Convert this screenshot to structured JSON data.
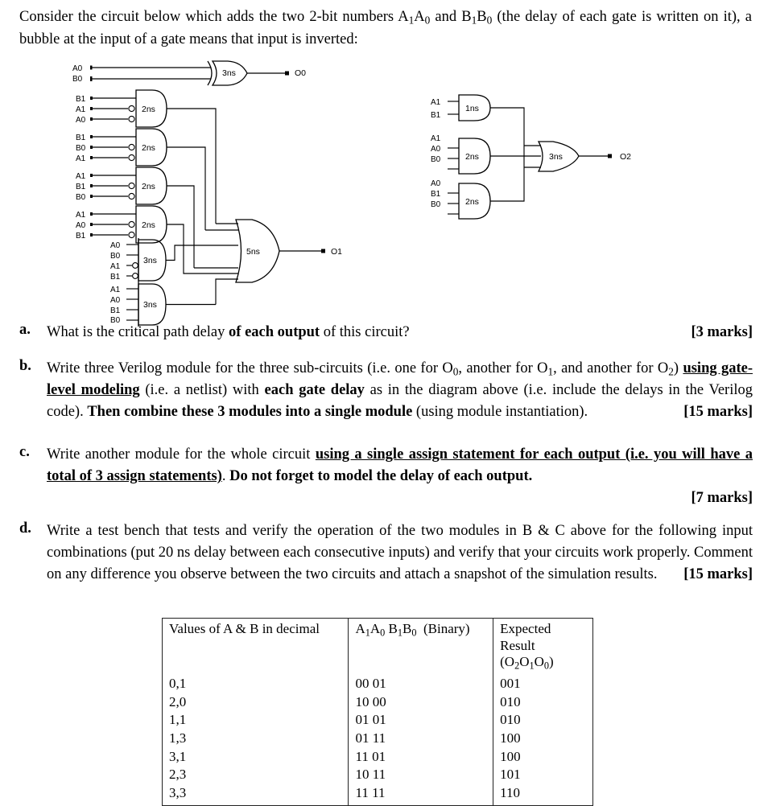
{
  "intro": {
    "text_part1": "Consider the circuit below which adds the two 2-bit numbers A",
    "sub_a1": "1",
    "text_part2": "A",
    "sub_a0": "0",
    "text_part3": " and B",
    "sub_b1": "1",
    "text_part4": "B",
    "sub_b0": "0",
    "text_part5": " (the delay of each gate is written on it), a bubble at the input of a gate means that input is inverted:",
    "full": "Consider the circuit below which adds the two 2-bit numbers A1A0 and B1B0 (the delay of each gate is written on it), a bubble at the input of a gate means that input is inverted:"
  },
  "circuit": {
    "o0": {
      "output_label": "O0",
      "gate": {
        "type": "xor",
        "delay": "3ns",
        "inputs": [
          "A0",
          "B0"
        ]
      }
    },
    "o1": {
      "output_label": "O1",
      "or_gate": {
        "type": "or",
        "delay": "5ns",
        "fan_in": 6
      },
      "and_gates": [
        {
          "delay": "2ns",
          "inputs": [
            "B1",
            "A1",
            "A0"
          ],
          "inverted": [
            false,
            true,
            true
          ]
        },
        {
          "delay": "2ns",
          "inputs": [
            "B1",
            "B0",
            "A1"
          ],
          "inverted": [
            false,
            true,
            true
          ]
        },
        {
          "delay": "2ns",
          "inputs": [
            "A1",
            "B1",
            "B0"
          ],
          "inverted": [
            false,
            true,
            true
          ]
        },
        {
          "delay": "2ns",
          "inputs": [
            "A1",
            "A0",
            "B1"
          ],
          "inverted": [
            false,
            true,
            true
          ]
        },
        {
          "delay": "3ns",
          "inputs": [
            "A0",
            "B0",
            "A1",
            "B1"
          ],
          "inverted": [
            false,
            false,
            true,
            true
          ]
        },
        {
          "delay": "3ns",
          "inputs": [
            "A1",
            "A0",
            "B1",
            "B0"
          ],
          "inverted": [
            false,
            false,
            false,
            false
          ]
        }
      ]
    },
    "o2": {
      "output_label": "O2",
      "or_gate": {
        "type": "or",
        "delay": "3ns",
        "fan_in": 3
      },
      "and_gates": [
        {
          "delay": "1ns",
          "inputs": [
            "A1",
            "B1"
          ],
          "inverted": [
            false,
            false
          ]
        },
        {
          "delay": "2ns",
          "inputs": [
            "A1",
            "A0",
            "B0"
          ],
          "inverted": [
            false,
            false,
            false
          ]
        },
        {
          "delay": "2ns",
          "inputs": [
            "A0",
            "B1",
            "B0"
          ],
          "inverted": [
            false,
            false,
            false
          ]
        }
      ]
    }
  },
  "questions": [
    {
      "marker": "a.",
      "marks": "[3 marks]",
      "segments": [
        {
          "text": "What is the critical path delay ",
          "style": "normal"
        },
        {
          "text": "of each output",
          "style": "bold"
        },
        {
          "text": " of this circuit?",
          "style": "normal"
        }
      ]
    },
    {
      "marker": "b.",
      "marks": "[15 marks]",
      "segments": [
        {
          "text": "Write three Verilog module for the three sub-circuits (i.e. one for O",
          "style": "normal"
        },
        {
          "text": "0",
          "style": "sub"
        },
        {
          "text": ", another for O",
          "style": "normal"
        },
        {
          "text": "1",
          "style": "sub"
        },
        {
          "text": ", and another for O",
          "style": "normal"
        },
        {
          "text": "2",
          "style": "sub"
        },
        {
          "text": ") ",
          "style": "normal"
        },
        {
          "text": "using gate-level modeling",
          "style": "bold-underline"
        },
        {
          "text": " (i.e. a netlist) with ",
          "style": "normal"
        },
        {
          "text": "each gate delay",
          "style": "bold"
        },
        {
          "text": " as in the diagram above (i.e. include the delays in the Verilog code).    ",
          "style": "normal"
        },
        {
          "text": "Then combine these 3 modules into a single module",
          "style": "bold"
        },
        {
          "text": " (using module instantiation).",
          "style": "normal"
        }
      ]
    },
    {
      "marker": "c.",
      "marks": "[7 marks]",
      "segments": [
        {
          "text": "Write another module for the whole circuit ",
          "style": "normal"
        },
        {
          "text": "using a single assign statement for each output (i.e. you will have a total of 3 assign statements)",
          "style": "bold-underline"
        },
        {
          "text": ". ",
          "style": "normal"
        },
        {
          "text": "Do not forget to model the delay of each output.",
          "style": "bold"
        }
      ]
    },
    {
      "marker": "d.",
      "marks": "[15 marks]",
      "segments": [
        {
          "text": "Write a test bench that tests and verify the operation of the two modules in B & C above for the following input combinations (put 20 ns delay between each consecutive inputs) and verify that your circuits work properly. Comment on any difference you observe between the two circuits and attach a snapshot of the simulation results.",
          "style": "normal"
        }
      ]
    }
  ],
  "results_table": {
    "headers": [
      "Values of A & B in decimal",
      "A1A0 B1B0  (Binary)",
      "Expected Result"
    ],
    "header3_line2": "(O2O1O0)",
    "rows": [
      {
        "decimal": "0,1",
        "binary": "00 01",
        "expected": "001"
      },
      {
        "decimal": "2,0",
        "binary": "10 00",
        "expected": "010"
      },
      {
        "decimal": "1,1",
        "binary": "01 01",
        "expected": "010"
      },
      {
        "decimal": "1,3",
        "binary": "01 11",
        "expected": "100"
      },
      {
        "decimal": "3,1",
        "binary": "11 01",
        "expected": "100"
      },
      {
        "decimal": "2,3",
        "binary": "10 11",
        "expected": "101"
      },
      {
        "decimal": "3,3",
        "binary": "11 11",
        "expected": "110"
      }
    ]
  }
}
